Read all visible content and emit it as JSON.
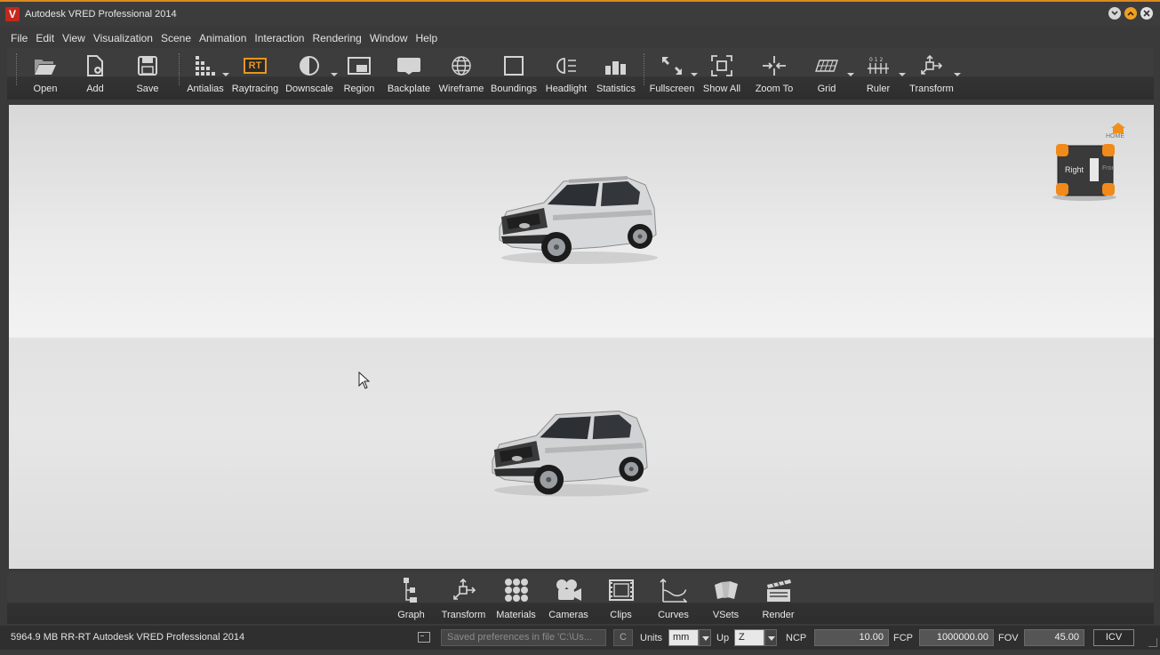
{
  "window": {
    "title": "Autodesk VRED Professional 2014",
    "logo_letter": "V",
    "accent_color": "#d98a1e"
  },
  "menu": [
    "File",
    "Edit",
    "View",
    "Visualization",
    "Scene",
    "Animation",
    "Interaction",
    "Rendering",
    "Window",
    "Help"
  ],
  "toolbar": {
    "open": "Open",
    "add": "Add",
    "save": "Save",
    "antialias": "Antialias",
    "raytracing": "Raytracing",
    "raytracing_badge": "RT",
    "downscale": "Downscale",
    "region": "Region",
    "backplate": "Backplate",
    "wireframe": "Wireframe",
    "boundings": "Boundings",
    "headlight": "Headlight",
    "statistics": "Statistics",
    "fullscreen": "Fullscreen",
    "show_all": "Show All",
    "zoom_to": "Zoom To",
    "grid": "Grid",
    "ruler": "Ruler",
    "transform": "Transform"
  },
  "viewport": {
    "navcube_right": "Right",
    "navcube_front": "Front",
    "home_label": "HOME"
  },
  "dock": {
    "graph": "Graph",
    "transform": "Transform",
    "materials": "Materials",
    "cameras": "Cameras",
    "clips": "Clips",
    "curves": "Curves",
    "vsets": "VSets",
    "render": "Render"
  },
  "status": {
    "memory": "5964.9 MB  RR-RT  Autodesk VRED Professional 2014",
    "message": "Saved preferences in file 'C:\\Us...",
    "c_button": "C",
    "units_label": "Units",
    "units_value": "mm",
    "up_label": "Up",
    "up_value": "Z",
    "ncp_label": "NCP",
    "ncp_value": "10.00",
    "fcp_label": "FCP",
    "fcp_value": "1000000.00",
    "fov_label": "FOV",
    "fov_value": "45.00",
    "icv_button": "ICV"
  }
}
